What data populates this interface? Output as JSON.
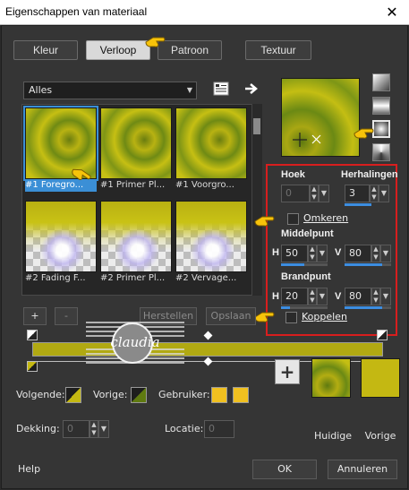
{
  "window": {
    "title": "Eigenschappen van materiaal",
    "close_glyph": "✕"
  },
  "tabs": [
    {
      "label": "Kleur",
      "active": false
    },
    {
      "label": "Verloop",
      "active": true
    },
    {
      "label": "Patroon",
      "active": false
    },
    {
      "label": "Textuur",
      "active": false
    }
  ],
  "category_select": {
    "value": "Alles"
  },
  "gradients": [
    {
      "label": "#1 Foregro...",
      "selected": true,
      "style": "radial"
    },
    {
      "label": "#1 Primer Pl...",
      "selected": false,
      "style": "radial"
    },
    {
      "label": "#1 Voorgro...",
      "selected": false,
      "style": "radial"
    },
    {
      "label": "#2 Fading F...",
      "selected": false,
      "style": "fade"
    },
    {
      "label": "#2 Primer Pl...",
      "selected": false,
      "style": "fade"
    },
    {
      "label": "#2 Vervage...",
      "selected": false,
      "style": "fade"
    }
  ],
  "settings": {
    "hoek_label": "Hoek",
    "hoek_value": "0",
    "herhalingen_label": "Herhalingen",
    "herhalingen_value": "3",
    "omkeren_label": "Omkeren",
    "middelpunt_label": "Middelpunt",
    "mid_h_label": "H",
    "mid_h_value": "50",
    "mid_v_label": "V",
    "mid_v_value": "80",
    "brandpunt_label": "Brandpunt",
    "brand_h_label": "H",
    "brand_h_value": "20",
    "brand_v_label": "V",
    "brand_v_value": "80",
    "koppelen_label": "Koppelen"
  },
  "editor": {
    "add_label": "+",
    "remove_label": "-",
    "restore_label": "Herstellen",
    "save_label": "Opslaan",
    "watermark_text": "claudia"
  },
  "colors": {
    "volgende_label": "Volgende:",
    "vorige_label": "Vorige:",
    "gebruiker_label": "Gebruiker:",
    "user_color_1": "#f0c020",
    "user_color_2": "#f0c020",
    "dekking_label": "Dekking:",
    "dekking_value": "0",
    "locatie_label": "Locatie:",
    "locatie_value": "0",
    "plus_label": "+",
    "huidige_label": "Huidige",
    "vorige_swatch_label": "Vorige",
    "vorige_swatch_color": "#c4b812"
  },
  "footer": {
    "help_label": "Help",
    "ok_label": "OK",
    "cancel_label": "Annuleren"
  },
  "accent": "#3b8fd6",
  "highlight_border": "#d81e1e"
}
